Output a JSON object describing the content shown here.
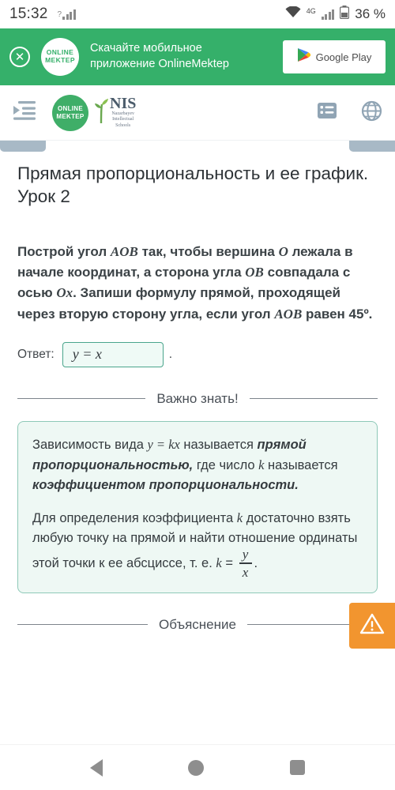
{
  "status_bar": {
    "time": "15:32",
    "signal_icon": "signal-bars-icon",
    "wifi_icon": "wifi-icon",
    "network_type": "4G",
    "battery_icon": "battery-icon",
    "battery_text": "36 %"
  },
  "banner": {
    "close_icon": "close-icon",
    "logo_line1": "ONLINE",
    "logo_line2": "MEKTEP",
    "text_line1": "Скачайте мобильное",
    "text_line2": "приложение OnlineMektep",
    "store_button_label": "Google Play",
    "store_icon": "google-play-icon",
    "background_color": "#35b06a"
  },
  "navbar": {
    "menu_icon": "menu-indent-icon",
    "mektep_logo_line1": "ONLINE",
    "mektep_logo_line2": "MEKTEP",
    "nis_logo_main": "NIS",
    "nis_logo_sub_line1": "Nazarbayev",
    "nis_logo_sub_line2": "Intellectual",
    "nis_logo_sub_line3": "Schools",
    "list_icon": "list-icon",
    "language_icon": "globe-icon"
  },
  "lesson": {
    "title": "Прямая пропорциональность и ее график. Урок 2"
  },
  "task": {
    "p1_a": "Построй угол ",
    "p1_m1": "AOB",
    "p1_b": " так, чтобы вершина ",
    "p1_m2": "O",
    "p1_c": " лежала в начале координат, а сторона угла ",
    "p1_m3": "OB",
    "p1_d": " совпадала с осью ",
    "p1_m4": "Ox",
    "p1_e": ". Запиши формулу прямой, проходящей через вторую сторону угла, если угол ",
    "p1_m5": "AOB",
    "p1_f": " равен 45º.",
    "answer_label": "Ответ:",
    "answer_value": "y = x",
    "answer_placeholder": "",
    "answer_period": "."
  },
  "important": {
    "divider_label": "Важно знать!",
    "para1_a": "Зависимость вида ",
    "para1_m1": "y = kx",
    "para1_b": " называется ",
    "para1_bold1": "прямой пропорциональностью,",
    "para1_c": " где число ",
    "para1_m2": "k",
    "para1_d": " называется ",
    "para1_bold2": "коэффициентом пропорциональности.",
    "para2_a": "Для определения коэффициента ",
    "para2_m1": "k",
    "para2_b": " достаточно взять любую точку на прямой и найти отношение ординаты этой точки к ее абсциссе, т. е. ",
    "para2_m2": "k",
    "para2_eq": " = ",
    "frac_num": "y",
    "frac_den": "x",
    "para2_end": "."
  },
  "explanation": {
    "divider_label": "Объяснение",
    "alert_icon": "warning-triangle-icon",
    "alert_color": "#f2952f"
  },
  "android_nav": {
    "back_icon": "back-triangle-icon",
    "home_icon": "home-circle-icon",
    "recents_icon": "recents-square-icon"
  }
}
